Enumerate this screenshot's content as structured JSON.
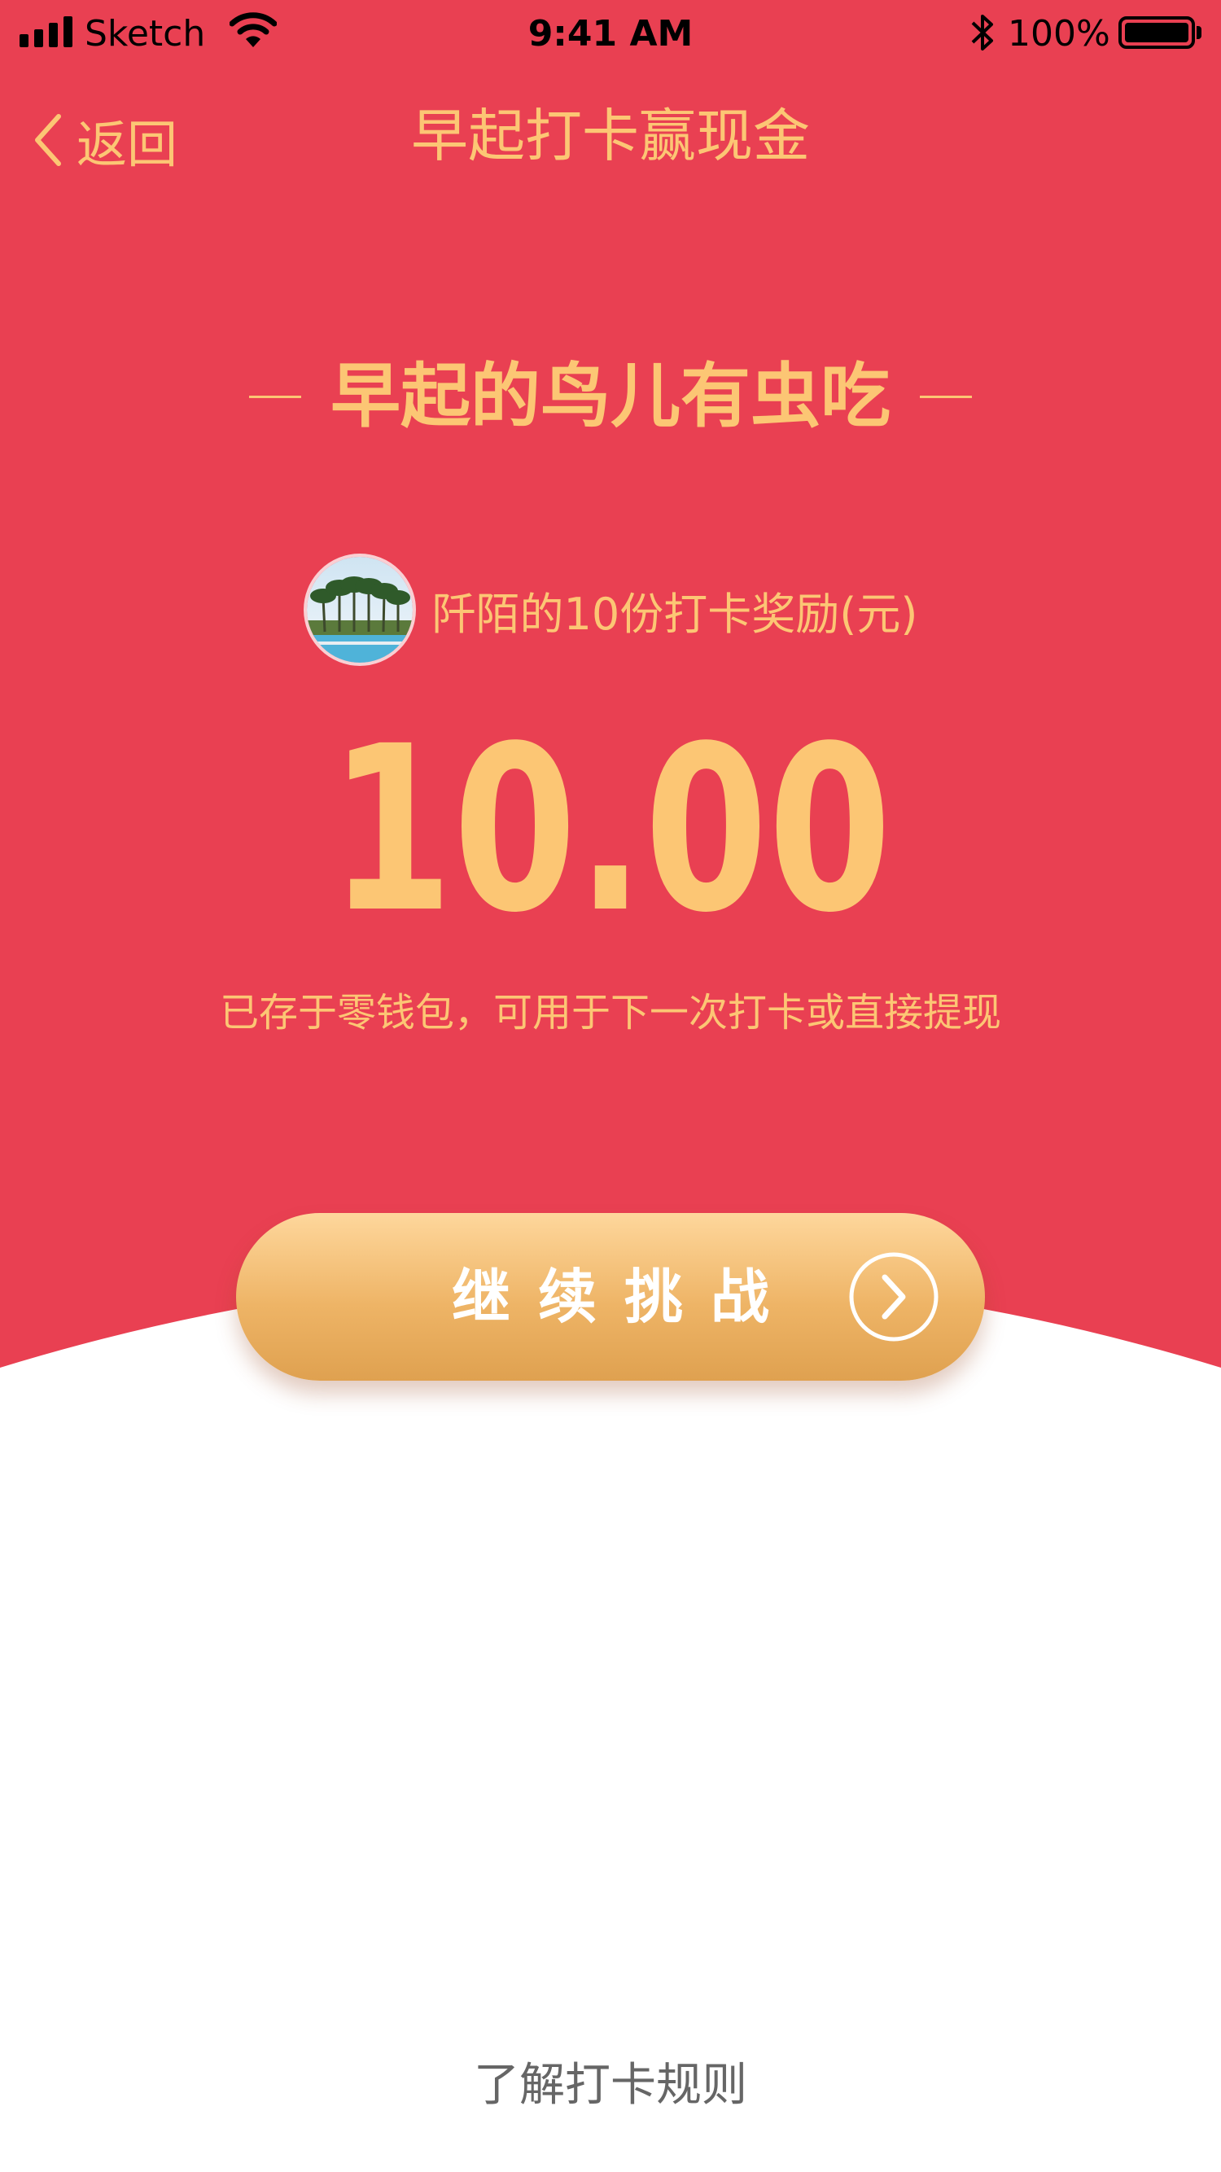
{
  "status_bar": {
    "carrier": "Sketch",
    "time": "9:41 AM",
    "battery": "100%"
  },
  "nav": {
    "back_label": "返回",
    "title": "早起打卡赢现金"
  },
  "headline": "早起的鸟儿有虫吃",
  "reward": {
    "label": "阡陌的10份打卡奖励(元)",
    "amount": "10.00",
    "note": "已存于零钱包，可用于下一次打卡或直接提现"
  },
  "actions": {
    "continue_label": "继续挑战",
    "rules_link": "了解打卡规则"
  },
  "colors": {
    "background_red": "#E94052",
    "accent_gold": "#FCC674",
    "button_gradient_top": "#FED79C",
    "button_gradient_bottom": "#DFA150"
  },
  "icons": {
    "back": "chevron-left-icon",
    "continue": "arrow-right-circle-icon",
    "signal": "cellular-signal-icon",
    "wifi": "wifi-icon",
    "bluetooth": "bluetooth-icon",
    "battery": "battery-icon"
  }
}
